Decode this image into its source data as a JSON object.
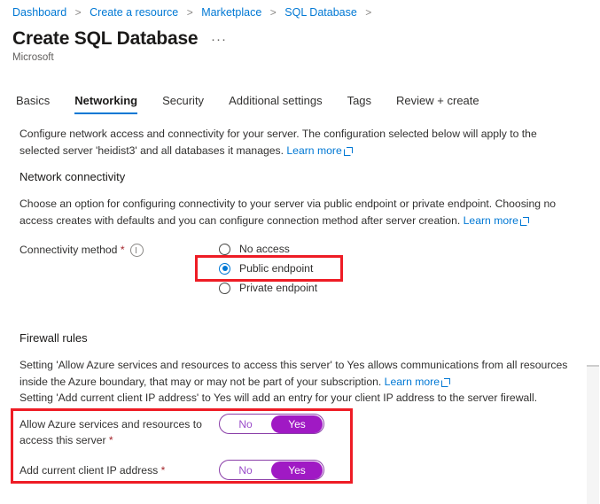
{
  "breadcrumb": {
    "separator": ">",
    "items": [
      {
        "label": "Dashboard"
      },
      {
        "label": "Create a resource"
      },
      {
        "label": "Marketplace"
      },
      {
        "label": "SQL Database"
      }
    ]
  },
  "header": {
    "title": "Create SQL Database",
    "ellipsis": "···",
    "subtitle": "Microsoft"
  },
  "tabs": [
    {
      "label": "Basics",
      "active": false
    },
    {
      "label": "Networking",
      "active": true
    },
    {
      "label": "Security",
      "active": false
    },
    {
      "label": "Additional settings",
      "active": false
    },
    {
      "label": "Tags",
      "active": false
    },
    {
      "label": "Review + create",
      "active": false
    }
  ],
  "intro": {
    "text": "Configure network access and connectivity for your server. The configuration selected below will apply to the selected server 'heidist3' and all databases it manages. ",
    "link": "Learn more"
  },
  "network_connectivity": {
    "heading": "Network connectivity",
    "description": "Choose an option for configuring connectivity to your server via public endpoint or private endpoint. Choosing no access creates with defaults and you can configure connection method after server creation. ",
    "link": "Learn more",
    "field_label": "Connectivity method",
    "required_marker": "*",
    "info_icon": "info-icon",
    "options": [
      {
        "label": "No access",
        "selected": false
      },
      {
        "label": "Public endpoint",
        "selected": true
      },
      {
        "label": "Private endpoint",
        "selected": false
      }
    ]
  },
  "firewall_rules": {
    "heading": "Firewall rules",
    "description_line1": "Setting 'Allow Azure services and resources to access this server' to Yes allows communications from all resources inside the Azure boundary, that may or may not be part of your subscription. ",
    "link": "Learn more",
    "description_line2": "Setting 'Add current client IP address' to Yes will add an entry for your client IP address to the server firewall.",
    "toggles": [
      {
        "label": "Allow Azure services and resources to access this server",
        "required_marker": "*",
        "off_label": "No",
        "on_label": "Yes",
        "value": "Yes"
      },
      {
        "label": "Add current client IP address",
        "required_marker": "*",
        "off_label": "No",
        "on_label": "Yes",
        "value": "Yes"
      }
    ]
  },
  "highlights": {
    "color": "#ee1c25",
    "boxes": [
      {
        "name": "connectivity-method-highlight"
      },
      {
        "name": "firewall-toggles-highlight"
      }
    ]
  },
  "colors": {
    "link": "#0078d4",
    "accent_tab": "#0078d4",
    "toggle_on": "#a019c4",
    "toggle_border": "#8a3ea8",
    "required": "#a4262c",
    "highlight": "#ee1c25"
  }
}
